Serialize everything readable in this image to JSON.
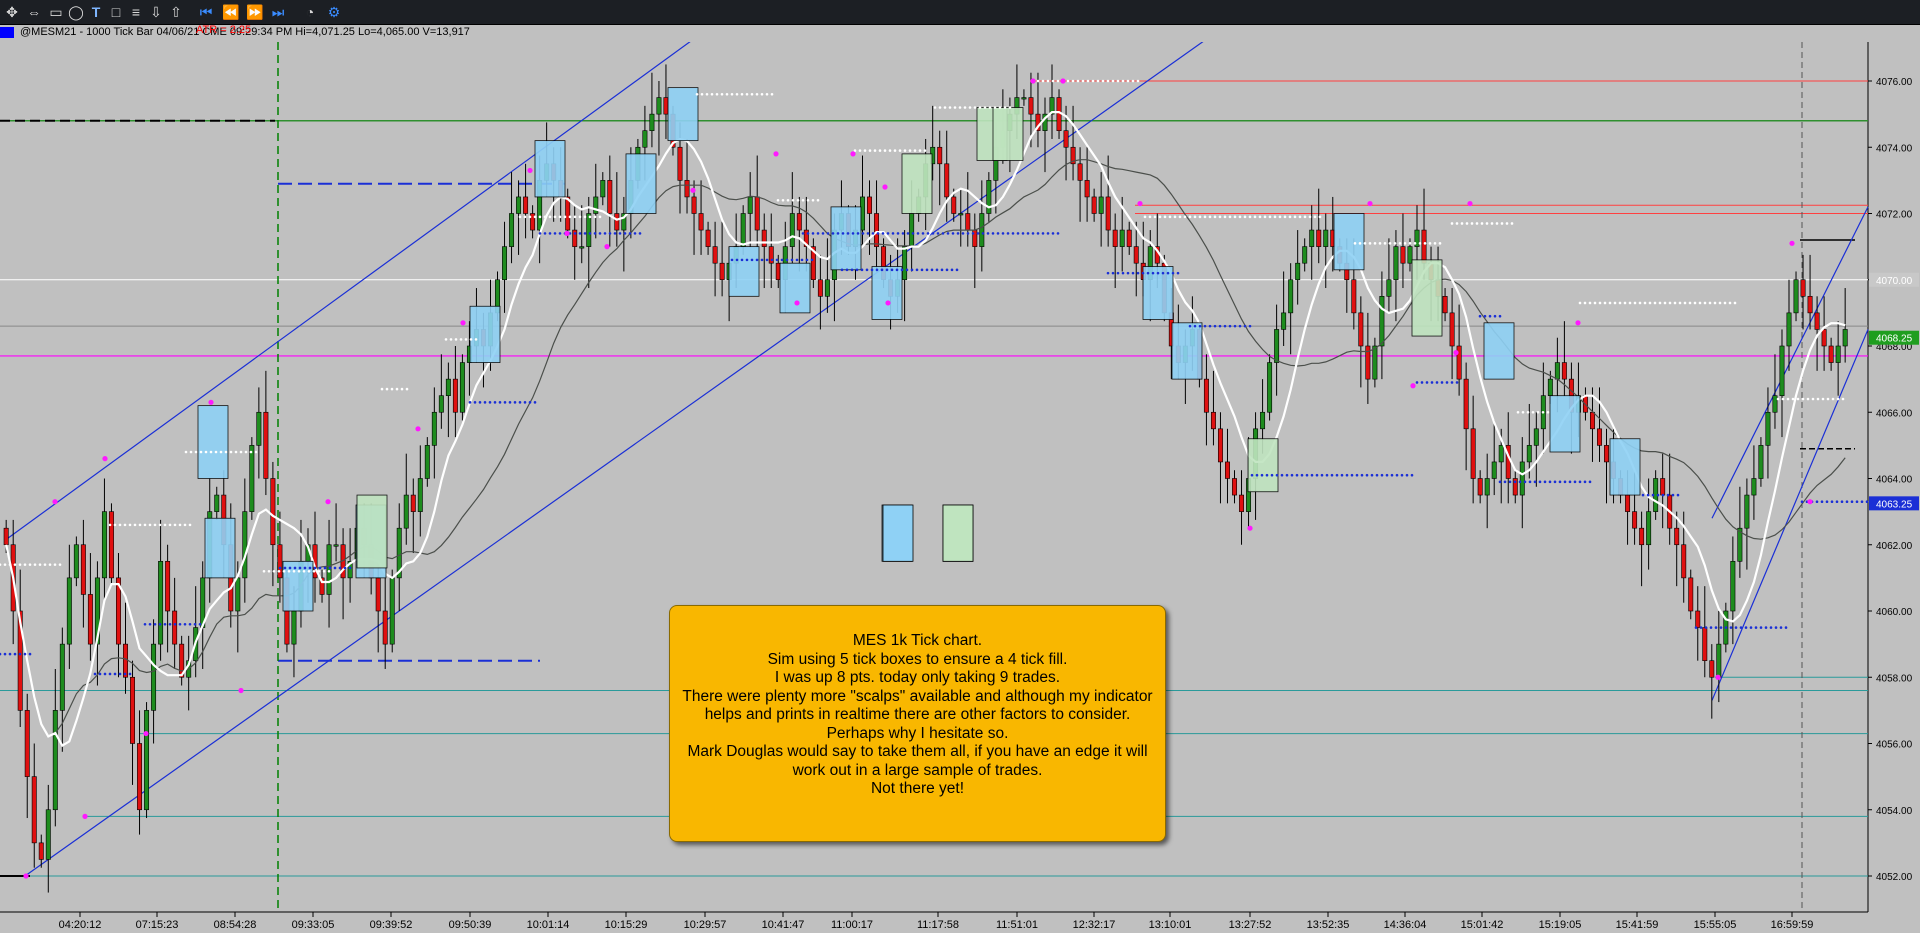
{
  "toolbar": {
    "icons": [
      "cursor-move-icon",
      "cross-arrows-icon",
      "rectangle-icon",
      "ellipse-icon",
      "text-tool-icon",
      "square-icon",
      "hamburger-lines-icon",
      "arrow-down-icon",
      "arrow-up-icon",
      "first-page-icon",
      "scroll-left-icon",
      "scroll-right-icon",
      "last-page-icon",
      "clock-icon",
      "settings-icon"
    ]
  },
  "header": {
    "title": "@MESM21 - 1000 Tick Bar  04/06/21  CME  09:29:34 PM  Hi=4,071.25  Lo=4,065.00  V=13,917",
    "atr": "ATR  = 2.25",
    "swatch_color": "#0000ff"
  },
  "note": {
    "lines": [
      "MES 1k Tick chart.",
      "Sim using 5 tick boxes to ensure a 4 tick fill.",
      "I was up 8 pts. today only taking 9 trades.",
      "There were plenty more \"scalps\" available and although my indicator helps and prints in realtime there are other factors to consider.",
      "Perhaps why I hesitate so.",
      "Mark Douglas would say to take them all, if you have an edge it will work out in a large sample of trades.",
      "Not there yet!"
    ]
  },
  "chart_data": {
    "type": "candlestick",
    "symbol": "@MESM21",
    "ylim": [
      4050.4,
      4077.2
    ],
    "y_ticks": [
      "4076.00",
      "4074.00",
      "4072.00",
      "4070.00",
      "4068.00",
      "4066.00",
      "4064.00",
      "4062.00",
      "4060.00",
      "4058.00",
      "4056.00",
      "4054.00",
      "4052.00"
    ],
    "x_ticks": [
      "04:20:12",
      "07:15:23",
      "08:54:28",
      "09:33:05",
      "09:39:52",
      "09:50:39",
      "10:01:14",
      "10:15:29",
      "10:29:57",
      "10:41:47",
      "11:00:17",
      "11:17:58",
      "11:51:01",
      "12:32:17",
      "13:10:01",
      "13:27:52",
      "13:52:35",
      "14:36:04",
      "15:01:42",
      "15:19:05",
      "15:41:59",
      "15:55:05",
      "16:59:59"
    ],
    "price_labels": [
      {
        "text": "4070.00",
        "value": 4070.0,
        "bg": "#c8c8c8",
        "fg": "#ffffff"
      },
      {
        "text": "4068.25",
        "value": 4068.25,
        "bg": "#1f9e1f",
        "fg": "#ffffff"
      },
      {
        "text": "4063.25",
        "value": 4063.25,
        "bg": "#1a2fd6",
        "fg": "#ffffff"
      }
    ],
    "closes": [
      4062,
      4060,
      4057,
      4055,
      4053,
      4052.5,
      4054,
      4057,
      4059,
      4061,
      4062,
      4060.5,
      4059,
      4061,
      4063,
      4061,
      4059,
      4058,
      4056,
      4054,
      4057,
      4059,
      4061.5,
      4060,
      4059,
      4058,
      4058.5,
      4059.5,
      4061,
      4063,
      4063.5,
      4062,
      4060,
      4061,
      4063,
      4065,
      4066,
      4064,
      4062,
      4061,
      4059,
      4060,
      4061.5,
      4062,
      4061,
      4060.5,
      4062,
      4062,
      4061,
      4061.5,
      4062.5,
      4062,
      4061,
      4060,
      4059,
      4061,
      4062.5,
      4063.5,
      4063,
      4064,
      4065,
      4066,
      4066.5,
      4067,
      4066,
      4067.5,
      4068,
      4068.5,
      4068,
      4069,
      4070,
      4071,
      4072,
      4072.5,
      4072,
      4071.5,
      4073,
      4073.5,
      4073,
      4072.5,
      4071.5,
      4071,
      4071,
      4072,
      4072.5,
      4073,
      4072,
      4071.5,
      4072,
      4073,
      4074,
      4074.5,
      4075,
      4075.5,
      4075,
      4074,
      4073,
      4072.5,
      4072,
      4071.5,
      4071,
      4070.5,
      4070,
      4070.5,
      4071,
      4072,
      4072.5,
      4071.5,
      4071,
      4070.5,
      4070,
      4071,
      4072,
      4071.5,
      4071,
      4070,
      4069.5,
      4070,
      4071.5,
      4072,
      4071,
      4071.5,
      4072.5,
      4072,
      4071,
      4070,
      4069.5,
      4070,
      4071,
      4072,
      4072.5,
      4073.5,
      4074,
      4073.5,
      4072.5,
      4072,
      4072,
      4071.5,
      4071,
      4072,
      4073,
      4074,
      4074.5,
      4075,
      4075.5,
      4075.5,
      4075,
      4074.5,
      4075,
      4075.5,
      4074.5,
      4074,
      4073.5,
      4073,
      4072.5,
      4072,
      4072.5,
      4071.5,
      4071,
      4071.5,
      4071,
      4070.5,
      4070,
      4071,
      4070.5,
      4069,
      4068,
      4067.5,
      4068,
      4068.5,
      4067,
      4066,
      4065.5,
      4064.5,
      4064,
      4063.5,
      4063,
      4064,
      4065.5,
      4066,
      4067.5,
      4068.5,
      4069,
      4070,
      4070.5,
      4071,
      4071.5,
      4071,
      4071.5,
      4071,
      4070.5,
      4070,
      4069,
      4068,
      4067,
      4068,
      4069.5,
      4070,
      4071,
      4070.5,
      4071,
      4071.5,
      4070.5,
      4070,
      4069.5,
      4069,
      4068,
      4067,
      4065.5,
      4064,
      4063.5,
      4064,
      4064.5,
      4065,
      4064,
      4063.5,
      4064.5,
      4065,
      4065.5,
      4066.5,
      4067,
      4067.5,
      4067,
      4066,
      4066.5,
      4066,
      4065.5,
      4065,
      4064.5,
      4064,
      4063.5,
      4063,
      4062.5,
      4062,
      4063,
      4064,
      4063.5,
      4062.5,
      4062,
      4061,
      4060,
      4059.5,
      4058.5,
      4058,
      4059,
      4060,
      4061.5,
      4062.5,
      4063.5,
      4064,
      4065,
      4066,
      4066.5,
      4068,
      4069,
      4070,
      4069.5,
      4069,
      4068.5,
      4068,
      4067.5,
      4068,
      4068.5
    ]
  }
}
